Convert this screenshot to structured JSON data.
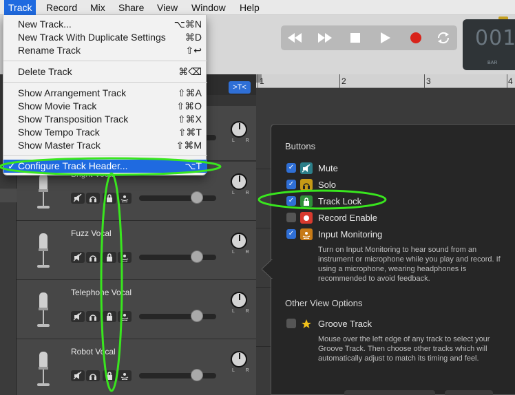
{
  "menubar": {
    "items": [
      "Track",
      "Record",
      "Mix",
      "Share",
      "View",
      "Window",
      "Help"
    ]
  },
  "track_menu": {
    "items": [
      {
        "label": "New Track...",
        "shortcut": "⌥⌘N"
      },
      {
        "label": "New Track With Duplicate Settings",
        "shortcut": "⌘D"
      },
      {
        "label": "Rename Track",
        "shortcut": "⇧↩"
      },
      {
        "label": "Delete Track",
        "shortcut": "⌘⌫"
      },
      {
        "label": "Show Arrangement Track",
        "shortcut": "⇧⌘A"
      },
      {
        "label": "Show Movie Track",
        "shortcut": "⇧⌘O"
      },
      {
        "label": "Show Transposition Track",
        "shortcut": "⇧⌘X"
      },
      {
        "label": "Show Tempo Track",
        "shortcut": "⇧⌘T"
      },
      {
        "label": "Show Master Track",
        "shortcut": "⇧⌘M"
      },
      {
        "label": "Configure Track Header...",
        "shortcut": "⌥T",
        "checked": "✓"
      }
    ]
  },
  "lcd": {
    "bars": "001",
    "bar_label": "BAR"
  },
  "ruler": {
    "marks": [
      "1",
      "2",
      "3",
      "4"
    ]
  },
  "filter_button": ">T<",
  "tracks": [
    {
      "name": "Bright Vocal"
    },
    {
      "name": "Fuzz Vocal"
    },
    {
      "name": "Telephone Vocal"
    },
    {
      "name": "Robot Vocal"
    }
  ],
  "pan_labels": "L R",
  "popover": {
    "buttons_title": "Buttons",
    "options": [
      {
        "label": "Mute",
        "checked": true,
        "icon": "mute-icon",
        "color": "#2c7f89"
      },
      {
        "label": "Solo",
        "checked": true,
        "icon": "headphones-icon",
        "color": "#c69a16"
      },
      {
        "label": "Track Lock",
        "checked": true,
        "icon": "lock-icon",
        "color": "#2f8f3a"
      },
      {
        "label": "Record Enable",
        "checked": false,
        "icon": "record-icon",
        "color": "#d83a2e"
      },
      {
        "label": "Input Monitoring",
        "checked": true,
        "icon": "input-monitoring-icon",
        "color": "#c77a16"
      }
    ],
    "input_monitoring_desc": "Turn on Input Monitoring to hear sound from an instrument or microphone while you play and record. If using a microphone, wearing headphones is recommended to avoid feedback.",
    "other_title": "Other View Options",
    "groove": {
      "label": "Groove Track",
      "checked": false,
      "icon": "star-icon",
      "color": "#f2c21b"
    },
    "groove_desc": "Mouse over the left edge of any track to select your Groove Track. Then choose other tracks which will automatically adjust to match its timing and feel."
  },
  "colors": {
    "menu_highlight": "#1f6ae0",
    "annotation": "#39e61e",
    "record": "#d8231a"
  }
}
